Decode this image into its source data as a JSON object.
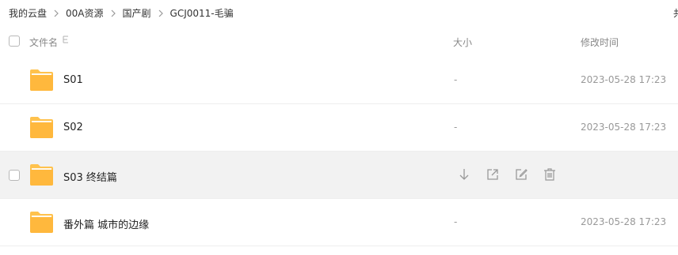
{
  "breadcrumb": {
    "items": [
      "我的云盘",
      "00A资源",
      "国产剧",
      "GCJ0011-毛骗"
    ],
    "count_cut": "共"
  },
  "columns": {
    "name": "文件名",
    "size": "大小",
    "modified": "修改时间"
  },
  "files": [
    {
      "name": "S01",
      "size": "-",
      "modified": "2023-05-28 17:23"
    },
    {
      "name": "S02",
      "size": "-",
      "modified": "2023-05-28 17:23"
    },
    {
      "name": "S03 终结篇",
      "size": "",
      "modified": ""
    },
    {
      "name": "番外篇 城市的边缘",
      "size": "-",
      "modified": "2023-05-28 17:23"
    }
  ],
  "hover_row_actions": [
    "download-icon",
    "share-icon",
    "rename-icon",
    "delete-icon"
  ],
  "colors": {
    "folder": "#ffc24d",
    "folder_dark": "#f5a623",
    "hover_row": "#f2f2f2"
  }
}
